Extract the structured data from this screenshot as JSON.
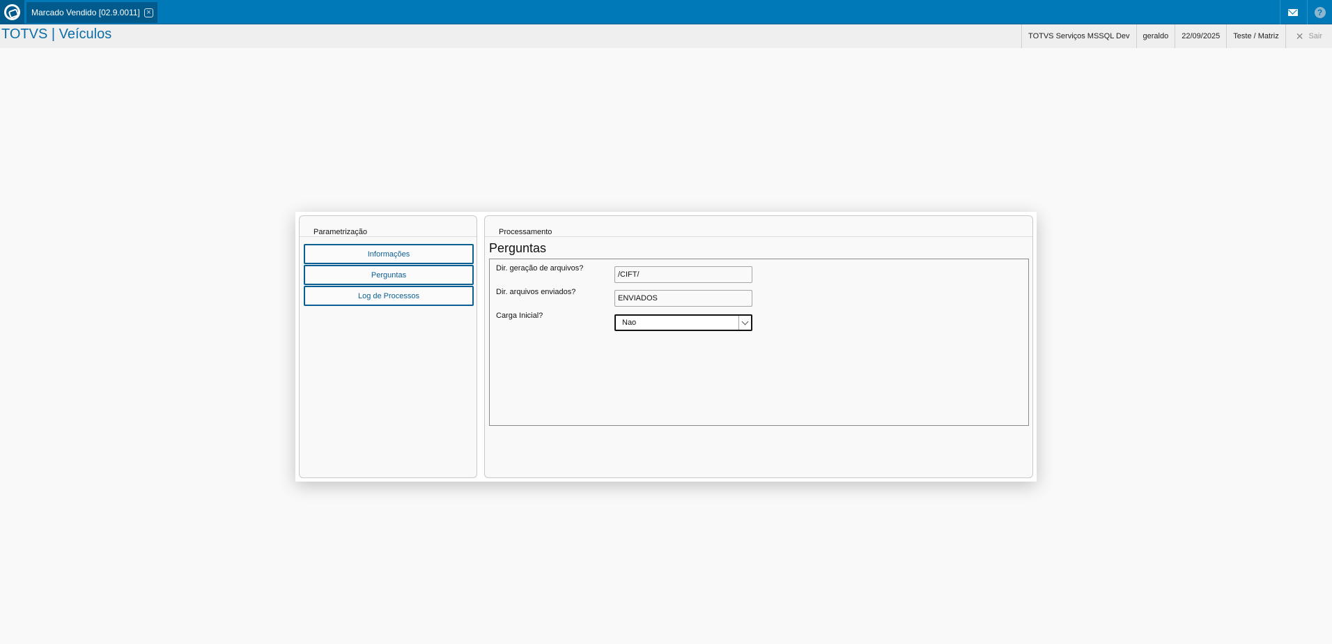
{
  "topbar": {
    "tab_label": "Marcado Vendido [02.9.0011]",
    "tab_close": "×",
    "mail_icon": "mail-icon",
    "help_icon": "help-icon",
    "help_glyph": "?"
  },
  "header": {
    "app_title": "TOTVS | Veículos",
    "environment": "TOTVS Serviços MSSQL Dev",
    "user": "geraldo",
    "date": "22/09/2025",
    "company": "Teste / Matriz",
    "exit_label": "Sair",
    "exit_glyph": "✕"
  },
  "left_panel": {
    "title": "Parametrização",
    "buttons": [
      "Informações",
      "Perguntas",
      "Log de Processos"
    ]
  },
  "right_panel": {
    "title": "Processamento",
    "section_title": "Perguntas",
    "questions": [
      {
        "label": "Dir. geração de arquivos?",
        "value": "/CIFT/"
      },
      {
        "label": "Dir. arquivos enviados?",
        "value": "ENVIADOS"
      },
      {
        "label": "Carga Inicial?",
        "value": "Nao"
      }
    ]
  },
  "colors": {
    "topbar": "#0079b8",
    "accent": "#0b5e92",
    "title": "#0b6ea8"
  }
}
